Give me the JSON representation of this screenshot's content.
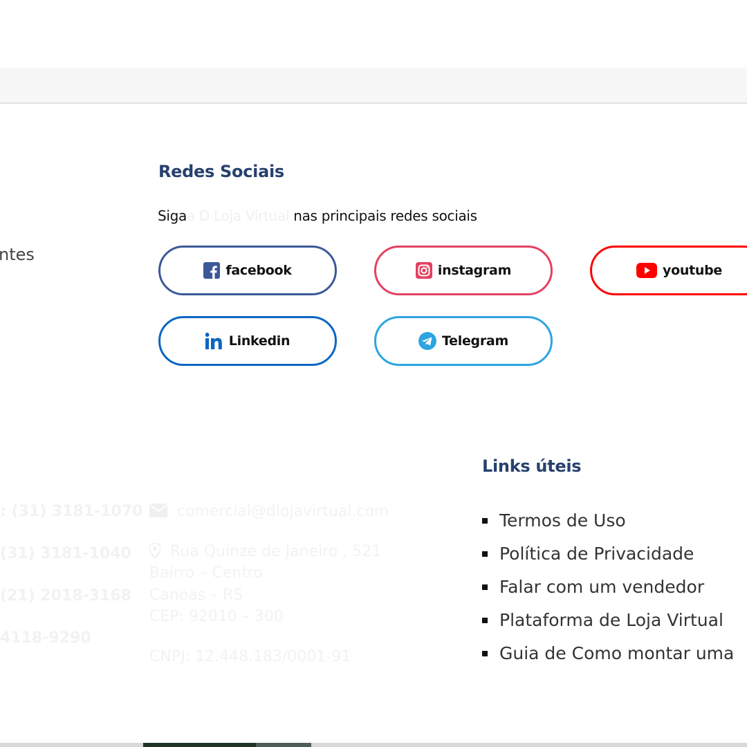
{
  "redes": {
    "title": "Redes Sociais",
    "desc_before": "Siga",
    "desc_brand": "a D Loja Virtual",
    "desc_after": " nas principais redes sociais"
  },
  "left_partial_text": "ntes",
  "social_buttons": [
    {
      "label": "facebook",
      "icon": "facebook-icon",
      "color": "#3b5998"
    },
    {
      "label": "instagram",
      "icon": "instagram-icon",
      "color": "#e4405f"
    },
    {
      "label": "youtube",
      "icon": "youtube-icon",
      "color": "#ff0000"
    },
    {
      "label": "Linkedin",
      "icon": "linkedin-icon",
      "color": "#0a66c2"
    },
    {
      "label": "Telegram",
      "icon": "telegram-icon",
      "color": "#2ca5e0"
    }
  ],
  "contacts": {
    "phones": [
      ": (31) 3181-1070",
      "(31) 3181-1040",
      " (21) 2018-3168",
      "4118-9290"
    ],
    "email": "comercial@dlojavirtual.com",
    "address": [
      "Rua Quinze de Janeiro , 521",
      "Bairro – Centro",
      "Canoas – RS",
      "CEP: 92010 – 300"
    ],
    "cnpj": "CNPJ: 12.448.183/0001-91"
  },
  "links": {
    "title": "Links úteis",
    "items": [
      "Termos de Uso",
      "Política de Privacidade",
      "Falar com um vendedor",
      "Plataforma de Loja Virtual",
      "Guia de Como montar uma"
    ]
  }
}
